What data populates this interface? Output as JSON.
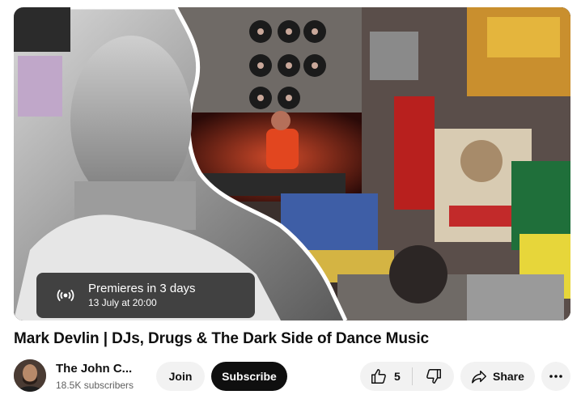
{
  "video": {
    "title": "Mark Devlin | DJs, Drugs & The Dark Side of Dance Music",
    "thumbnail_icon": "collage-thumbnail",
    "premiere": {
      "label": "Premieres in 3 days",
      "date": "13 July at 20:00",
      "icon": "broadcast-icon"
    }
  },
  "channel": {
    "name": "The John C...",
    "subscribers": "18.5K subscribers",
    "join_label": "Join",
    "subscribe_label": "Subscribe"
  },
  "actions": {
    "like_count": "5",
    "share_label": "Share",
    "icons": [
      "thumbs-up-icon",
      "thumbs-down-icon",
      "share-icon",
      "more-icon"
    ]
  },
  "colors": {
    "subscribe_bg": "#0f0f0f",
    "pill_bg": "#f2f2f2",
    "secondary_text": "#606060"
  }
}
